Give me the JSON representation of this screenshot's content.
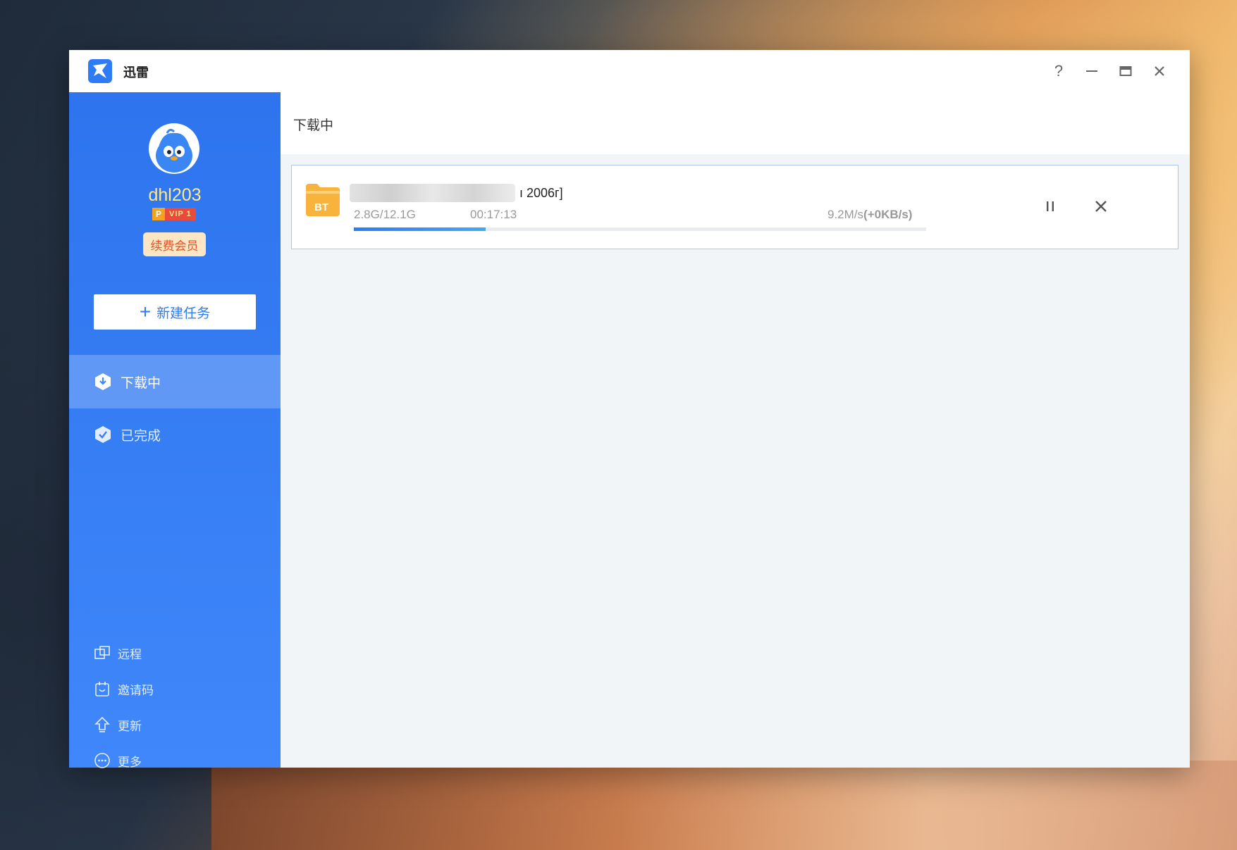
{
  "app": {
    "title": "迅雷"
  },
  "window_controls": {
    "help": "?",
    "minimize": "—",
    "maximize": "▭",
    "close": "✕"
  },
  "user": {
    "username": "dhl203",
    "vip_prefix": "P",
    "vip_level": "VIP 1",
    "renew_label": "续费会员"
  },
  "sidebar": {
    "new_task_plus": "+",
    "new_task_label": "新建任务",
    "nav": [
      {
        "label": "下载中",
        "icon": "download-icon",
        "active": true
      },
      {
        "label": "已完成",
        "icon": "check-shield-icon",
        "active": false
      }
    ],
    "bottom": [
      {
        "label": "远程",
        "icon": "remote-icon"
      },
      {
        "label": "邀请码",
        "icon": "invite-code-icon"
      },
      {
        "label": "更新",
        "icon": "update-icon"
      },
      {
        "label": "更多",
        "icon": "more-icon"
      }
    ]
  },
  "main": {
    "header_title": "下载中",
    "tasks": [
      {
        "type_badge": "BT",
        "name_visible_suffix": "ı 2006г]",
        "size_progress": "2.8G/12.1G",
        "time_remaining": "00:17:13",
        "speed": "9.2M/s",
        "speed_boost": "(+0KB/s)",
        "progress_fraction": 0.23
      }
    ]
  },
  "colors": {
    "accent": "#2e7bf6",
    "sidebar_top": "#2d74ee",
    "sidebar_bottom": "#3f87fa",
    "vip_gold": "#ffe98a",
    "renew_bg": "#fde6c3",
    "renew_text": "#e2532a",
    "folder": "#f7b33b"
  }
}
